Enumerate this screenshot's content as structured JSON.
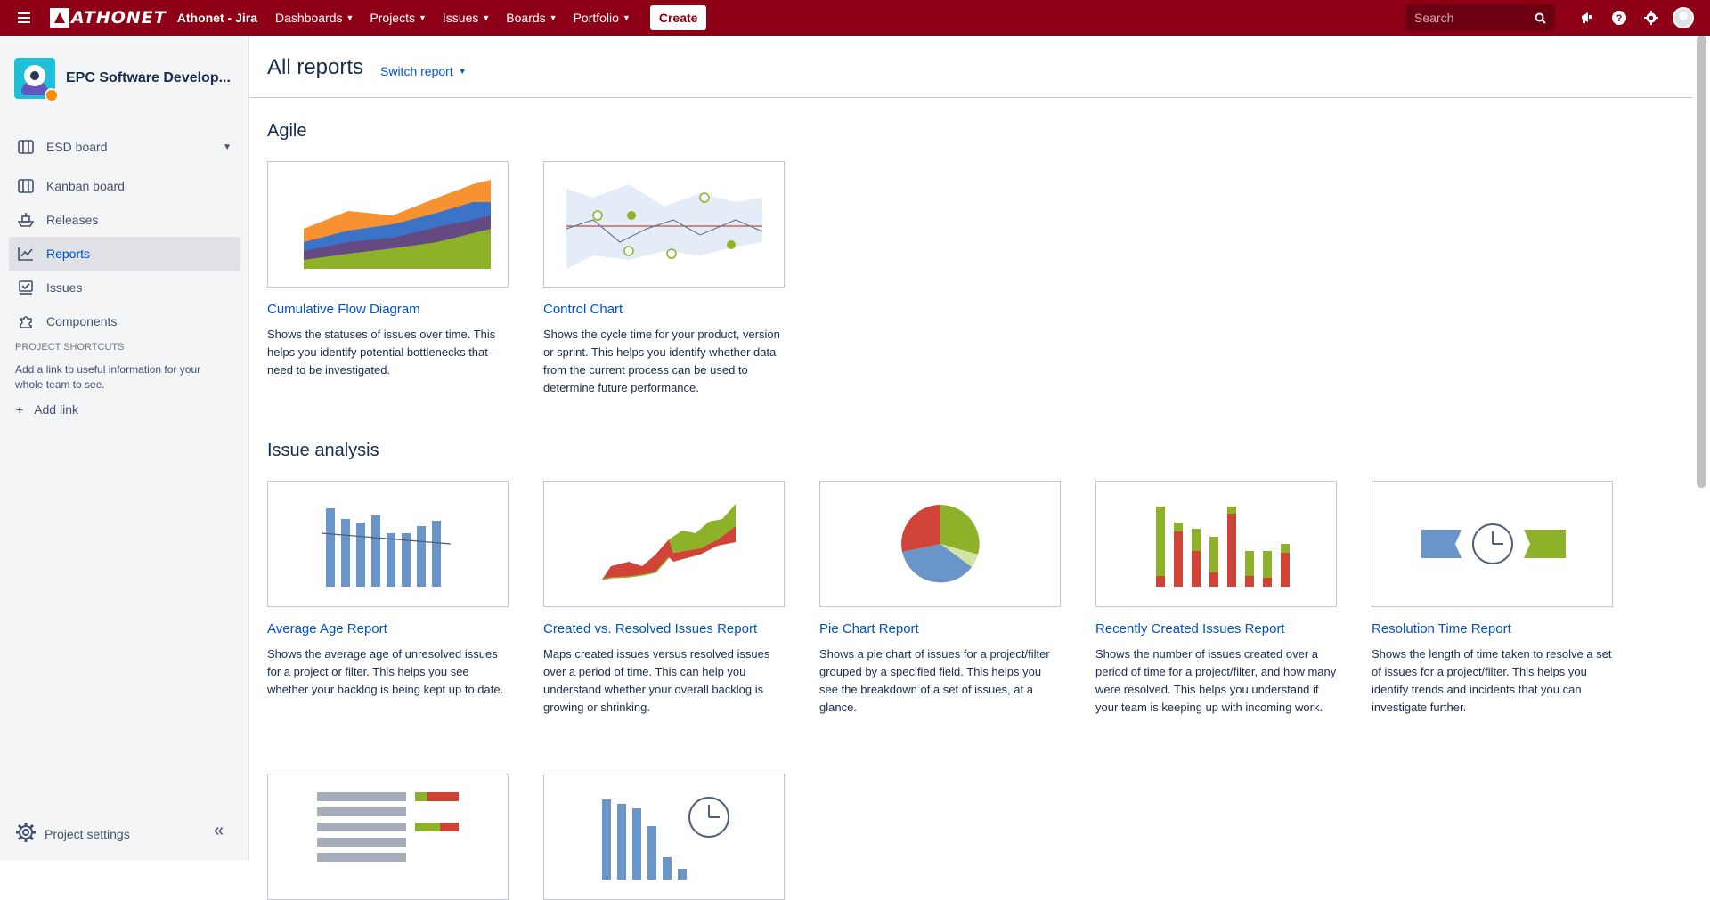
{
  "topnav": {
    "brand": "ATHONET",
    "site_title": "Athonet - Jira",
    "menu": [
      "Dashboards",
      "Projects",
      "Issues",
      "Boards",
      "Portfolio"
    ],
    "create_label": "Create",
    "search_placeholder": "Search",
    "icons": [
      "notifications-icon",
      "help-icon",
      "settings-icon",
      "avatar"
    ]
  },
  "sidebar": {
    "project_name": "EPC Software Develop...",
    "board_selector": "ESD board",
    "items": [
      "Kanban board",
      "Releases",
      "Reports",
      "Issues",
      "Components"
    ],
    "active_item": "Reports",
    "shortcuts_heading": "PROJECT SHORTCUTS",
    "shortcuts_text": "Add a link to useful information for your whole team to see.",
    "add_link": "Add link",
    "project_settings": "Project settings"
  },
  "page": {
    "title": "All reports",
    "switch_report": "Switch report"
  },
  "sections": {
    "agile": {
      "heading": "Agile",
      "cards": [
        {
          "title": "Cumulative Flow Diagram",
          "desc": "Shows the statuses of issues over time. This helps you identify potential bottlenecks that need to be investigated."
        },
        {
          "title": "Control Chart",
          "desc": "Shows the cycle time for your product, version or sprint. This helps you identify whether data from the current process can be used to determine future performance."
        }
      ]
    },
    "issue_analysis": {
      "heading": "Issue analysis",
      "cards": [
        {
          "title": "Average Age Report",
          "desc": "Shows the average age of unresolved issues for a project or filter. This helps you see whether your backlog is being kept up to date."
        },
        {
          "title": "Created vs. Resolved Issues Report",
          "desc": "Maps created issues versus resolved issues over a period of time. This can help you understand whether your overall backlog is growing or shrinking."
        },
        {
          "title": "Pie Chart Report",
          "desc": "Shows a pie chart of issues for a project/filter grouped by a specified field. This helps you see the breakdown of a set of issues, at a glance."
        },
        {
          "title": "Recently Created Issues Report",
          "desc": "Shows the number of issues created over a period of time for a project/filter, and how many were resolved. This helps you understand if your team is keeping up with incoming work."
        },
        {
          "title": "Resolution Time Report",
          "desc": "Shows the length of time taken to resolve a set of issues for a project/filter. This helps you identify trends and incidents that you can investigate further."
        }
      ]
    }
  },
  "colors": {
    "brand_red": "#8e0016",
    "link_blue": "#0052cc",
    "chart_green": "#8db22a",
    "chart_red": "#d04437",
    "chart_blue": "#6a95c8",
    "chart_orange": "#f79232",
    "chart_purple": "#654982"
  }
}
